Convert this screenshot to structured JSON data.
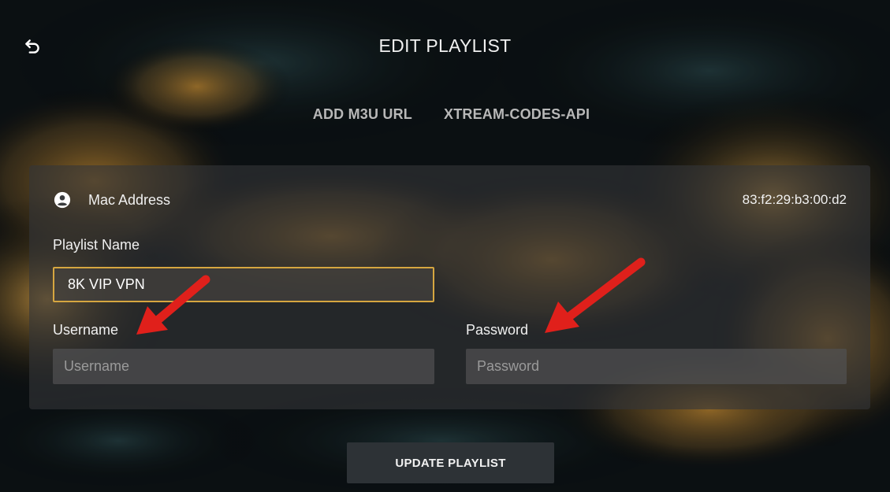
{
  "header": {
    "back_icon": "undo-arrow-icon",
    "title": "EDIT PLAYLIST"
  },
  "tabs": [
    {
      "label": "ADD M3U URL"
    },
    {
      "label": "XTREAM-CODES-API"
    }
  ],
  "device": {
    "icon": "user-circle-icon",
    "label": "Mac Address",
    "value": "83:f2:29:b3:00:d2"
  },
  "form": {
    "playlist_name": {
      "label": "Playlist Name",
      "value": "8K VIP VPN"
    },
    "username": {
      "label": "Username",
      "value": "",
      "placeholder": "Username"
    },
    "password": {
      "label": "Password",
      "value": "",
      "placeholder": "Password"
    }
  },
  "actions": {
    "update_label": "UPDATE PLAYLIST"
  },
  "annotations": {
    "arrow_color": "#e0201b",
    "arrows": [
      "pointer-arrow-username",
      "pointer-arrow-password"
    ]
  },
  "colors": {
    "accent_border": "#d6a640",
    "background": "#0d1316"
  }
}
